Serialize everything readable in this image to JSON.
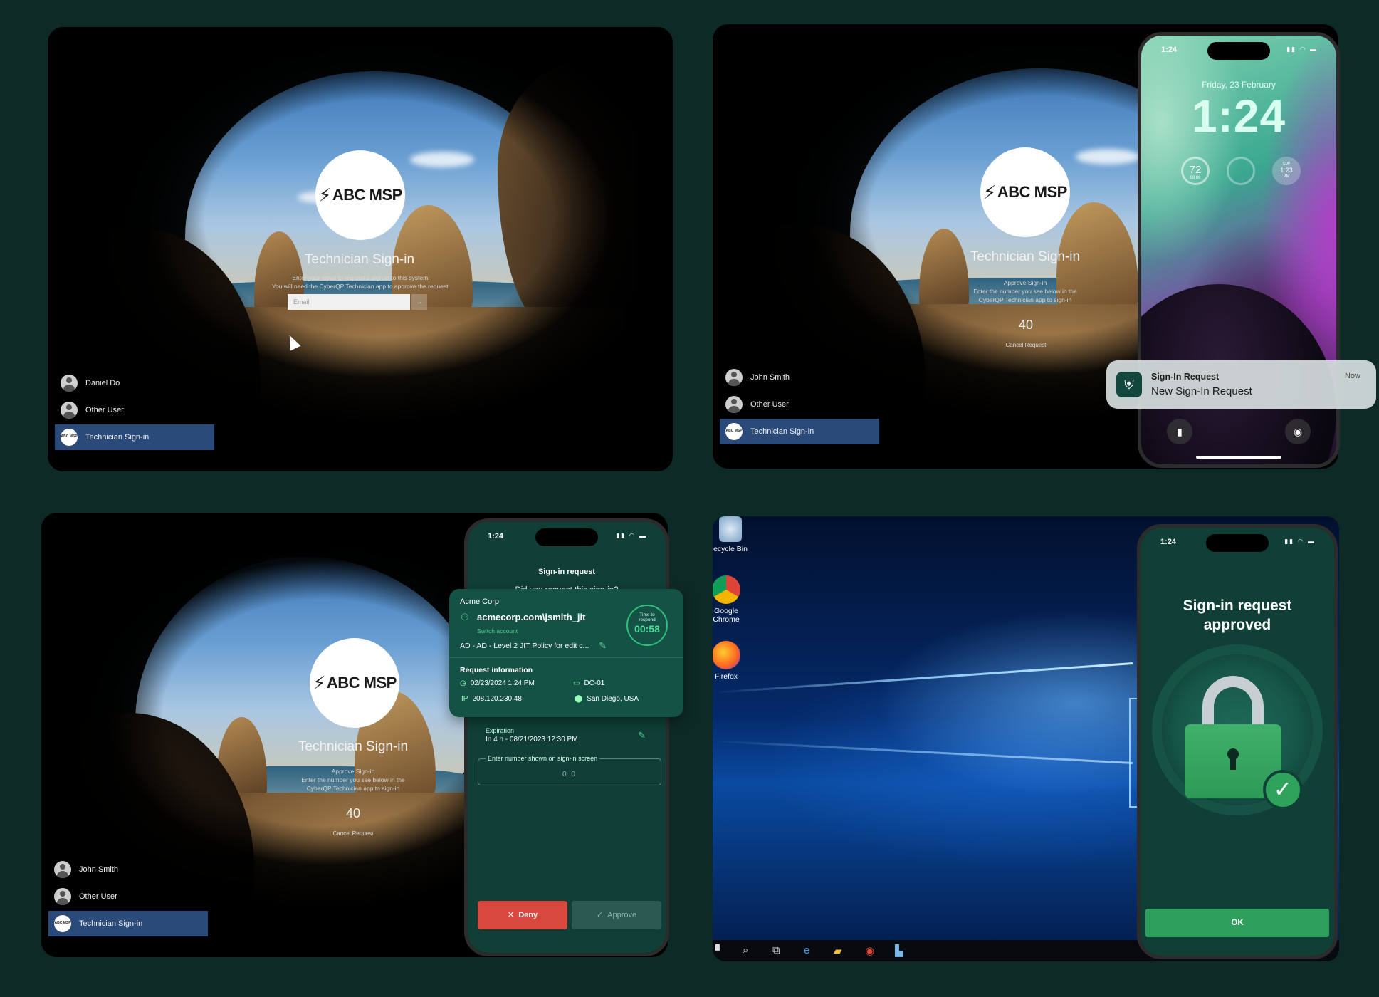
{
  "brand": {
    "logo_text": "ABC MSP",
    "accent": "#2f9f5e",
    "deny_color": "#d8483f",
    "selected_user_bg": "#2a4a7a"
  },
  "panel1": {
    "title": "Technician Sign-in",
    "subtitle_line1": "Enter your email to request a sign-in to this system.",
    "subtitle_line2": "You will need the CyberQP Technician app to approve the request.",
    "email_placeholder": "Email",
    "submit_icon": "arrow-right-icon",
    "users": [
      "Daniel Do",
      "Other User",
      "Technician Sign-in"
    ]
  },
  "panel2": {
    "title": "Technician Sign-in",
    "subtitle_line1": "Approve Sign-in",
    "subtitle_line2": "Enter the number you see below in the",
    "subtitle_line3": "CyberQP Technician app to sign-in",
    "number": "40",
    "cancel": "Cancel Request",
    "users": [
      "John Smith",
      "Other User",
      "Technician Sign-in"
    ],
    "phone": {
      "status_time": "1:24",
      "date": "Friday, 23 February",
      "time": "1:24",
      "widget_temp": "72",
      "widget_temp_range": "68 86",
      "widget_cup": "CUP",
      "widget_clock": "1:23",
      "widget_pm": "PM"
    },
    "notification": {
      "title": "Sign-In Request",
      "body": "New Sign-In Request",
      "time": "Now"
    }
  },
  "panel3": {
    "title": "Technician Sign-in",
    "subtitle_line1": "Approve Sign-in",
    "subtitle_line2": "Enter the number you see below in the",
    "subtitle_line3": "CyberQP Technician app to sign-in",
    "number": "40",
    "cancel": "Cancel Request",
    "users": [
      "John Smith",
      "Other User",
      "Technician Sign-in"
    ],
    "phone": {
      "status_time": "1:24",
      "header": "Sign-in request",
      "question": "Did you request this sign-in?",
      "org": "Acme Corp",
      "account": "acmecorp.com\\jsmith_jit",
      "switch_account": "Switch account",
      "policy": "AD - AD - Level 2 JIT Policy for edit c...",
      "timer_label_1": "Time to",
      "timer_label_2": "respond",
      "timer_value": "00:58",
      "request_info": "Request information",
      "date": "02/23/2024 1:24 PM",
      "device": "DC-01",
      "ip_label": "IP",
      "ip": "208.120.230.48",
      "location": "San Diego, USA",
      "expiration_label": "Expiration",
      "expiration_value": "In 4 h - 08/21/2023 12:30 PM",
      "number_field_label": "Enter number shown on sign-in screen",
      "number_field_value": "0 0",
      "deny": "Deny",
      "approve": "Approve"
    }
  },
  "panel4": {
    "desktop_icons": [
      "ecycle Bin",
      "Google Chrome",
      "Firefox"
    ],
    "phone": {
      "status_time": "1:24",
      "title_line1": "Sign-in request",
      "title_line2": "approved",
      "ok": "OK"
    }
  }
}
